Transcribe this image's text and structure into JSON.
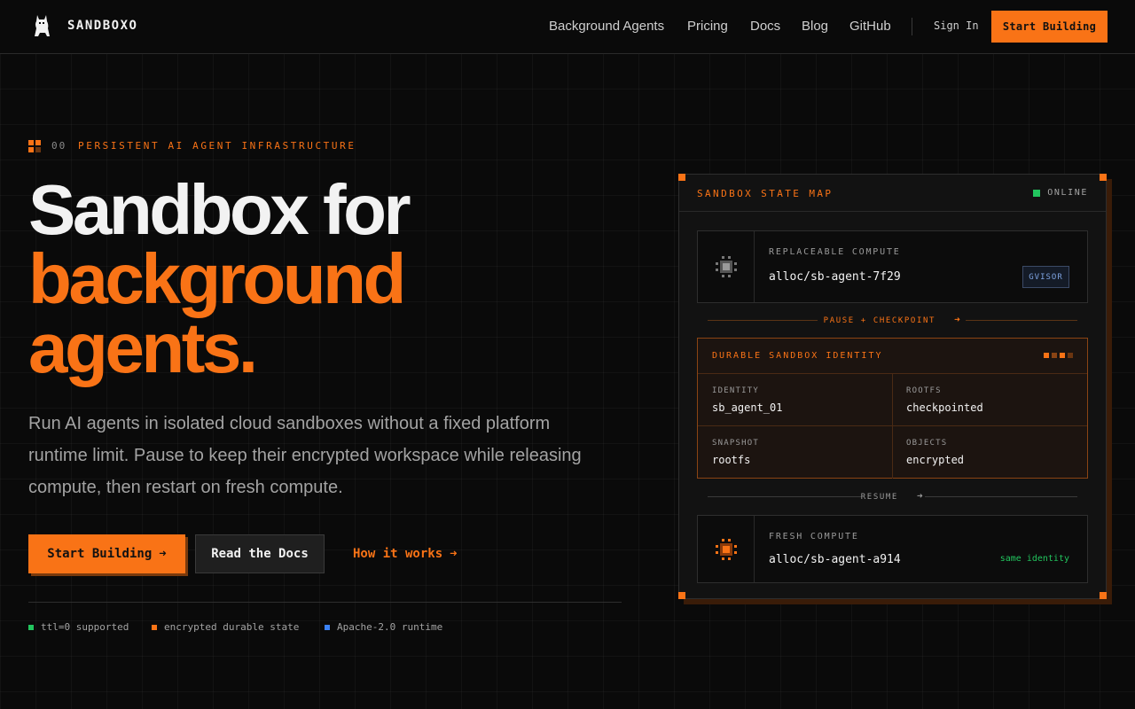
{
  "nav": {
    "brand": "SANDBOXO",
    "links": [
      "Background Agents",
      "Pricing",
      "Docs",
      "Blog",
      "GitHub"
    ],
    "sign_in": "Sign In",
    "cta": "Start Building"
  },
  "hero": {
    "eyebrow_num": "00",
    "eyebrow_text": "PERSISTENT AI AGENT INFRASTRUCTURE",
    "headline_line1": "Sandbox for",
    "headline_line2": "background",
    "headline_line3": "agents.",
    "lede": "Run AI agents in isolated cloud sandboxes without a fixed platform runtime limit. Pause to keep their encrypted workspace while releasing compute, then restart on fresh compute.",
    "primary_cta": "Start Building",
    "secondary_cta": "Read the Docs",
    "link_cta": "How it works",
    "features": [
      {
        "text": "ttl=0 supported",
        "color": "#22c55e"
      },
      {
        "text": "encrypted durable state",
        "color": "#f97316"
      },
      {
        "text": "Apache-2.0 runtime",
        "color": "#3b82f6"
      }
    ]
  },
  "state_map": {
    "title": "SANDBOX STATE MAP",
    "status": "ONLINE",
    "replaceable": {
      "label": "REPLACEABLE COMPUTE",
      "value": "alloc/sb-agent-7f29",
      "badge": "GVISOR"
    },
    "transition_pause": "PAUSE + CHECKPOINT",
    "identity": {
      "title": "DURABLE SANDBOX IDENTITY",
      "cells": [
        {
          "key": "IDENTITY",
          "value": "sb_agent_01"
        },
        {
          "key": "ROOTFS",
          "value": "checkpointed"
        },
        {
          "key": "SNAPSHOT",
          "value": "rootfs"
        },
        {
          "key": "OBJECTS",
          "value": "encrypted"
        }
      ]
    },
    "transition_resume": "RESUME",
    "fresh": {
      "label": "FRESH COMPUTE",
      "value": "alloc/sb-agent-a914",
      "note": "same identity"
    }
  },
  "colors": {
    "accent": "#f97316",
    "background": "#0a0a0a",
    "online": "#22c55e",
    "badge": "#7ea3e0"
  }
}
